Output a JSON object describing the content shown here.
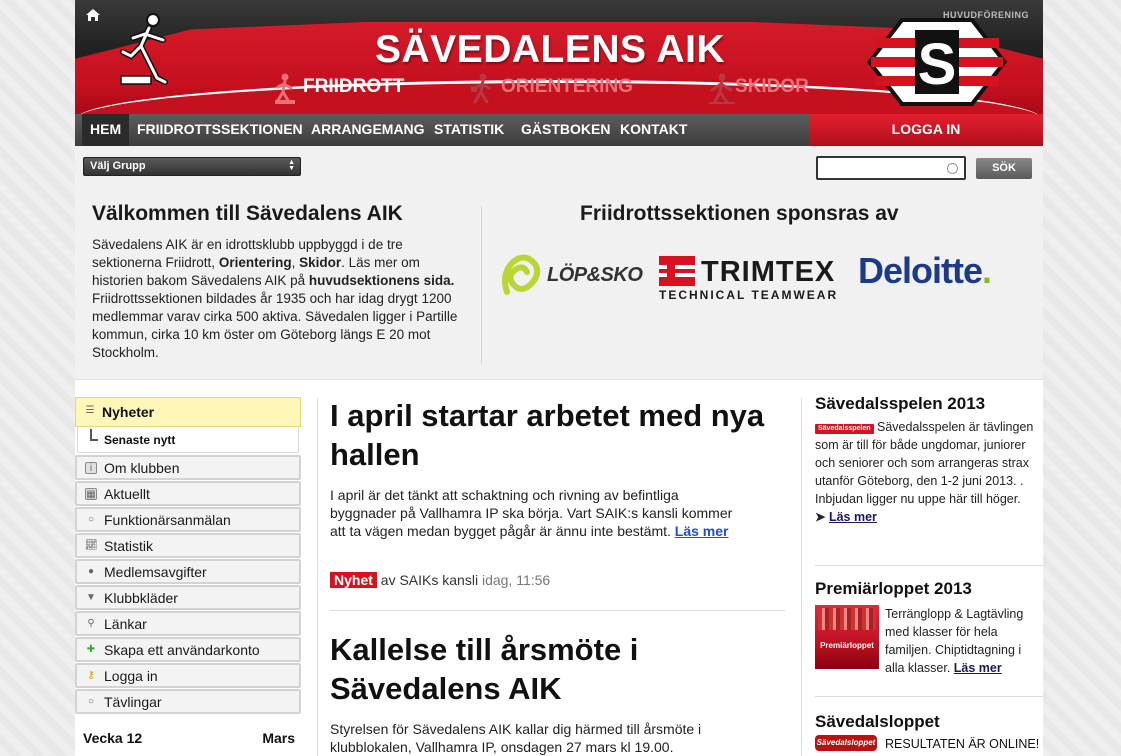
{
  "header": {
    "top_right_link": "HUVUDFÖRENING",
    "site_title": "SÄVEDALENS AIK",
    "sections": [
      {
        "label": "FRIIDROTT"
      },
      {
        "label": "ORIENTERING"
      },
      {
        "label": "SKIDOR"
      }
    ],
    "logo_letter": "S"
  },
  "nav": {
    "items": [
      {
        "label": "HEM"
      },
      {
        "label": "FRIIDROTTSSEKTIONEN"
      },
      {
        "label": "ARRANGEMANG"
      },
      {
        "label": "STATISTIK"
      },
      {
        "label": "GÄSTBOKEN"
      },
      {
        "label": "KONTAKT"
      }
    ],
    "login": "LOGGA IN"
  },
  "filter": {
    "select_value": "Välj Grupp",
    "search_value": "",
    "search_button": "SÖK"
  },
  "welcome": {
    "title": "Välkommen till Sävedalens AIK",
    "text_1": "Sävedalens AIK är en idrottsklubb uppbyggd i de tre sektionerna Friidrott, ",
    "text_orient": "Orientering",
    "text_sep": ", ",
    "text_skidor": "Skidor",
    "text_2": ". Läs mer om historien bakom Sävedalens AIK på ",
    "text_link": "huvudsektionens sida.",
    "text_3": " Friidrottssektionen bildades år 1935 och har idag drygt 1200 medlemmar varav cirka 500 aktiva. Sävedalen ligger i Partille kommun, cirka 10 km öster om Göteborg längs E 20 mot Stockholm."
  },
  "sponsors": {
    "title": "Friidrottssektionen sponsras av",
    "lopsko": "LÖP&SKO",
    "trimtex_name": "TRIMTEX",
    "trimtex_sub": "TECHNICAL TEAMWEAR",
    "deloitte": "Deloitte",
    "deloitte_dot": "."
  },
  "menu": {
    "active": "Nyheter",
    "sub": "Senaste nytt",
    "items": [
      {
        "label": "Om klubben",
        "icon": "info-icon"
      },
      {
        "label": "Aktuellt",
        "icon": "calendar-icon"
      },
      {
        "label": "Funktionärsanmälan",
        "icon": "circle-icon"
      },
      {
        "label": "Statistik",
        "icon": "chart-icon"
      },
      {
        "label": "Medlemsavgifter",
        "icon": "coins-icon"
      },
      {
        "label": "Klubbkläder",
        "icon": "shirt-icon"
      },
      {
        "label": "Länkar",
        "icon": "link-icon"
      },
      {
        "label": "Skapa ett användarkonto",
        "icon": "user-add-icon"
      },
      {
        "label": "Logga in",
        "icon": "key-icon"
      },
      {
        "label": "Tävlingar",
        "icon": "circle-icon"
      }
    ],
    "week": "Vecka 12",
    "month": "Mars"
  },
  "articles": [
    {
      "title": "I april startar arbetet med nya hallen",
      "text": "I april är det tänkt att schaktning och rivning av befintliga byggnader på Vallhamra IP ska börja. Vart SAIK:s kansli kommer att ta vägen medan bygget pågår är ännu inte bestämt. ",
      "read_more": "Läs mer",
      "badge": "Nyhet",
      "author": " av SAIKs kansli ",
      "time": "idag, 11:56"
    },
    {
      "title": "Kallelse till årsmöte i Sävedalens AIK",
      "text": "Styrelsen för Sävedalens AIK kallar dig härmed till årsmöte i klubblokalen, Vallhamra IP, onsdagen 27 mars kl 19.00."
    }
  ],
  "right": {
    "spelen_title": "Sävedalsspelen 2013",
    "spelen_badge": "Sävedalsspelen",
    "spelen_text": " Sävedalsspelen är tävlingen som är till för både ungdomar, juniorer och seniorer och som arrangeras strax utanför Göteborg, den 1-2 juni 2013. . Inbjudan ligger nu uppe här till höger.",
    "spelen_arrow": "➤ ",
    "spelen_readmore": "Läs mer",
    "premiar_title": "Premiärloppet 2013",
    "premiar_img_text": "Premiärloppet",
    "premiar_text": "Terränglopp & Lagtävling med klasser för hela familjen. Chiptidtagning i alla klasser. ",
    "premiar_readmore": "Läs mer",
    "loppet_title": "Sävedalsloppet",
    "loppet_logo": "Sävedalsloppet",
    "loppet_text": "RESULTATEN ÄR ONLINE!"
  }
}
